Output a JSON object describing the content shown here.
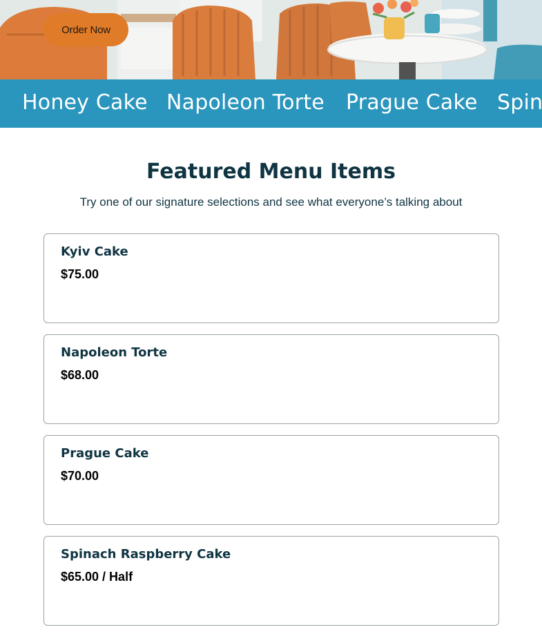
{
  "hero": {
    "order_button_label": "Order Now"
  },
  "marquee": {
    "items": [
      "Honey Cake",
      "Napoleon Torte",
      "Prague Cake",
      "Spinach Raspberry Cake"
    ]
  },
  "featured": {
    "title": "Featured Menu Items",
    "subtitle": "Try one of our signature selections and see what everyone’s talking about",
    "items": [
      {
        "name": "Kyiv Cake",
        "price": "$75.00"
      },
      {
        "name": "Napoleon Torte",
        "price": "$68.00"
      },
      {
        "name": "Prague Cake",
        "price": "$70.00"
      },
      {
        "name": "Spinach Raspberry Cake",
        "price": "$65.00 / Half"
      }
    ]
  },
  "colors": {
    "accent_orange": "#e07b27",
    "strip_blue": "#2a95bd",
    "heading_navy": "#0f3442"
  }
}
